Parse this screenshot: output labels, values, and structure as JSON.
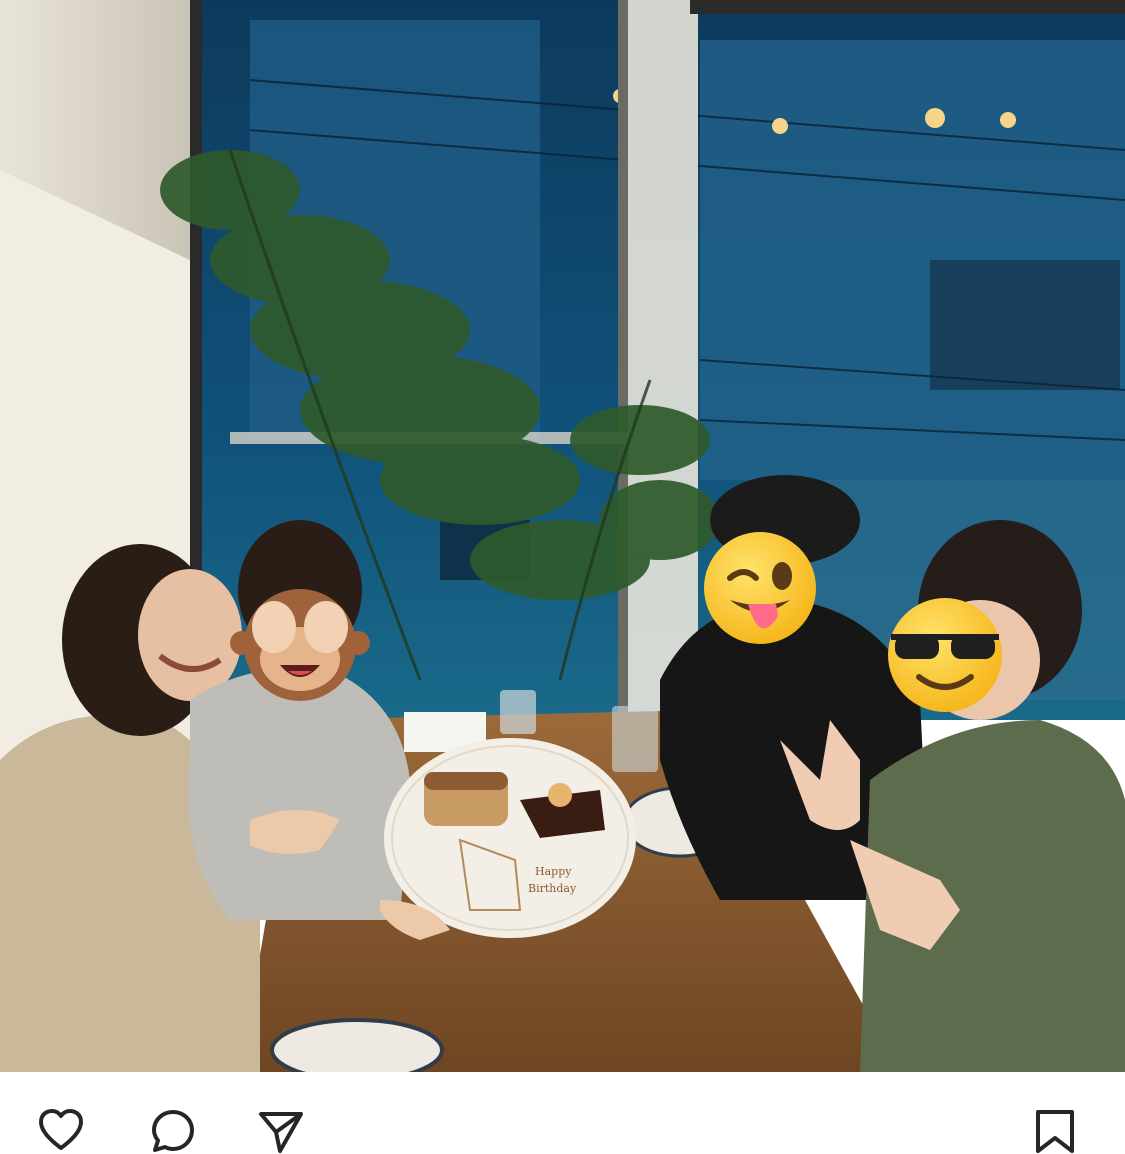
{
  "post": {
    "photo": {
      "description_icon": "photo",
      "emoji_overlays": [
        "see-no-evil-monkey-icon",
        "winking-face-with-tongue-icon",
        "smiling-face-with-sunglasses-icon"
      ],
      "plate_text": [
        "Happy",
        "Birthday"
      ]
    },
    "actions": [
      {
        "name": "like",
        "icon": "heart-icon"
      },
      {
        "name": "comment",
        "icon": "comment-icon"
      },
      {
        "name": "share",
        "icon": "paper-plane-icon"
      },
      {
        "name": "save",
        "icon": "bookmark-icon"
      }
    ]
  },
  "colors": {
    "background": "#ffffff",
    "icon_stroke": "#262626"
  }
}
